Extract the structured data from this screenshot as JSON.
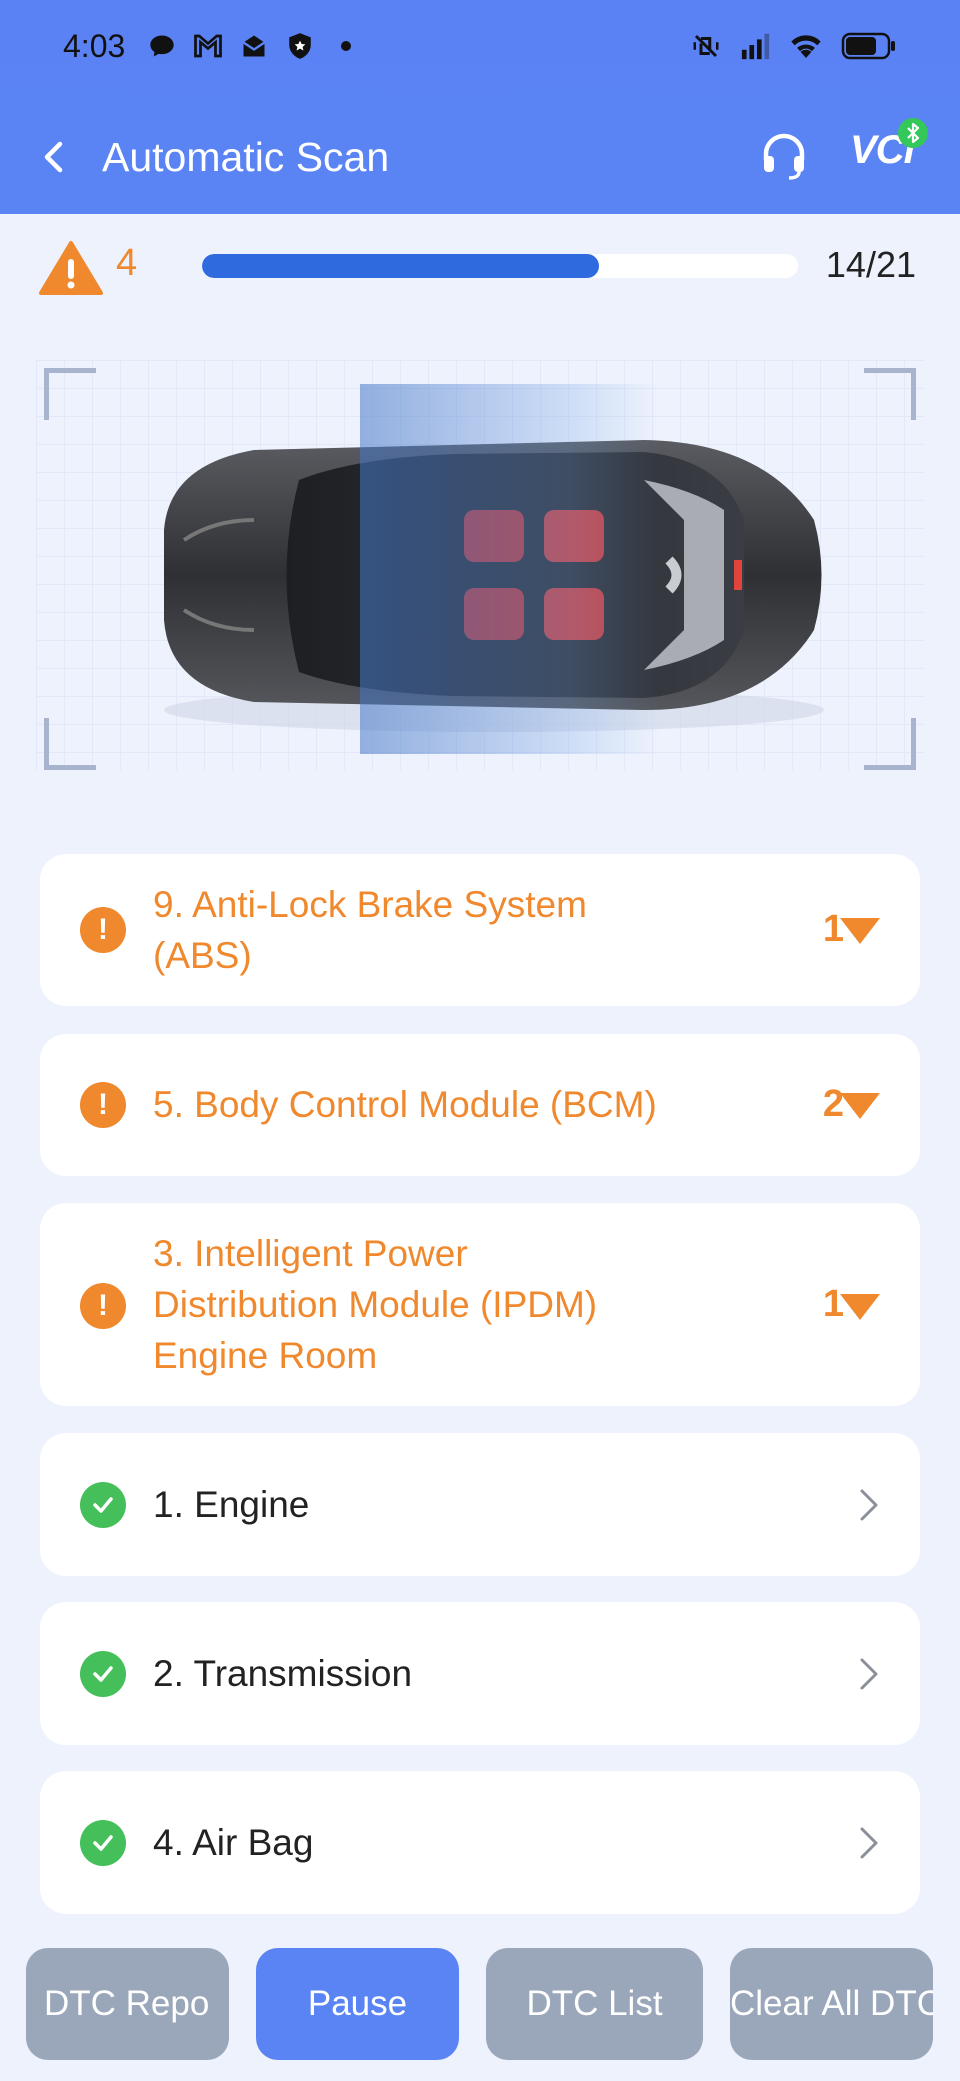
{
  "status_bar": {
    "time": "4:03",
    "left_icons": [
      "chat-bubble-icon",
      "gmail-icon",
      "mail-open-icon",
      "shield-icon",
      "dot-icon"
    ],
    "right_icons": [
      "vibrate-off-icon",
      "signal-icon",
      "wifi-icon",
      "battery-icon"
    ]
  },
  "header": {
    "title": "Automatic Scan",
    "vci_label": "VCI",
    "back_icon": "chevron-left-icon",
    "support_icon": "headset-icon",
    "bluetooth_icon": "bluetooth-icon"
  },
  "progress": {
    "warning_count": "4",
    "current": 14,
    "total": 21,
    "text": "14/21"
  },
  "systems": [
    {
      "name": "9. Anti-Lock Brake System\n(ABS)",
      "status": "fault",
      "count": "1"
    },
    {
      "name": "5. Body Control Module (BCM)",
      "status": "fault",
      "count": "2"
    },
    {
      "name": "3. Intelligent Power\nDistribution Module (IPDM)\nEngine Room",
      "status": "fault",
      "count": "1"
    },
    {
      "name": "1. Engine",
      "status": "ok"
    },
    {
      "name": "2. Transmission",
      "status": "ok"
    },
    {
      "name": "4. Air Bag",
      "status": "ok"
    }
  ],
  "bottom_buttons": {
    "dtc_report": "DTC Repo",
    "pause": "Pause",
    "dtc_list": "DTC List",
    "clear_all": "Clear All DTC"
  },
  "colors": {
    "header": "#5a84f4",
    "progress": "#2f6bdf",
    "fault": "#f0882d",
    "ok": "#44bf5a",
    "button_gray": "#9aa6b9"
  }
}
